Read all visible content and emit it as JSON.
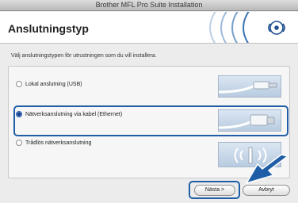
{
  "window": {
    "title": "Brother MFL Pro Suite Installation"
  },
  "header": {
    "title": "Anslutningstyp"
  },
  "instruction": "Välj anslutningstypen för utrustningen som du vill installera.",
  "options": [
    {
      "label": "Lokal anslutning (USB)",
      "selected": false
    },
    {
      "label": "Nätverksanslutning via kabel (Ethernet)",
      "selected": true
    },
    {
      "label": "Trådlös nätverksanslutning",
      "selected": false
    }
  ],
  "buttons": {
    "next": "Nästa >",
    "cancel": "Avbryt"
  },
  "colors": {
    "highlight": "#1f5ea6",
    "accent_blue": "#2a5aa8"
  }
}
